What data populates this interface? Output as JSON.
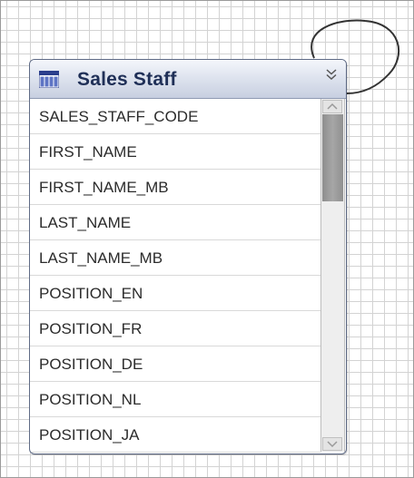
{
  "table": {
    "title": "Sales Staff",
    "header_color": "#c7cfe0",
    "title_color": "#1f2f57",
    "fields": [
      "SALES_STAFF_CODE",
      "FIRST_NAME",
      "FIRST_NAME_MB",
      "LAST_NAME",
      "LAST_NAME_MB",
      "POSITION_EN",
      "POSITION_FR",
      "POSITION_DE",
      "POSITION_NL",
      "POSITION_JA"
    ],
    "scroll_position": 0
  },
  "icons": {
    "table": "table-icon",
    "collapse": "chevron-double-down-icon",
    "scroll_up": "arrow-up-icon",
    "scroll_down": "arrow-down-icon"
  }
}
